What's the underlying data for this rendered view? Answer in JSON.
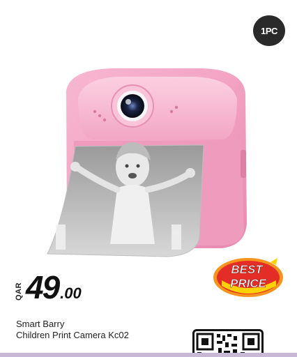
{
  "badge": {
    "quantity": "1PC"
  },
  "product": {
    "image_subject": "pink-instant-print-kids-camera",
    "title_line1": "Smart Barry",
    "title_line2": "Children Print Camera Kc02"
  },
  "price": {
    "currency": "QAR",
    "whole": "49",
    "decimal": ".00"
  },
  "promo": {
    "line1": "BEST",
    "line2": "PRICE"
  },
  "colors": {
    "camera_pink": "#f4a9c6",
    "badge_bg": "#2a2a2a",
    "promo_red": "#e52d27",
    "promo_orange": "#f7941d",
    "promo_yellow": "#ffd200"
  }
}
